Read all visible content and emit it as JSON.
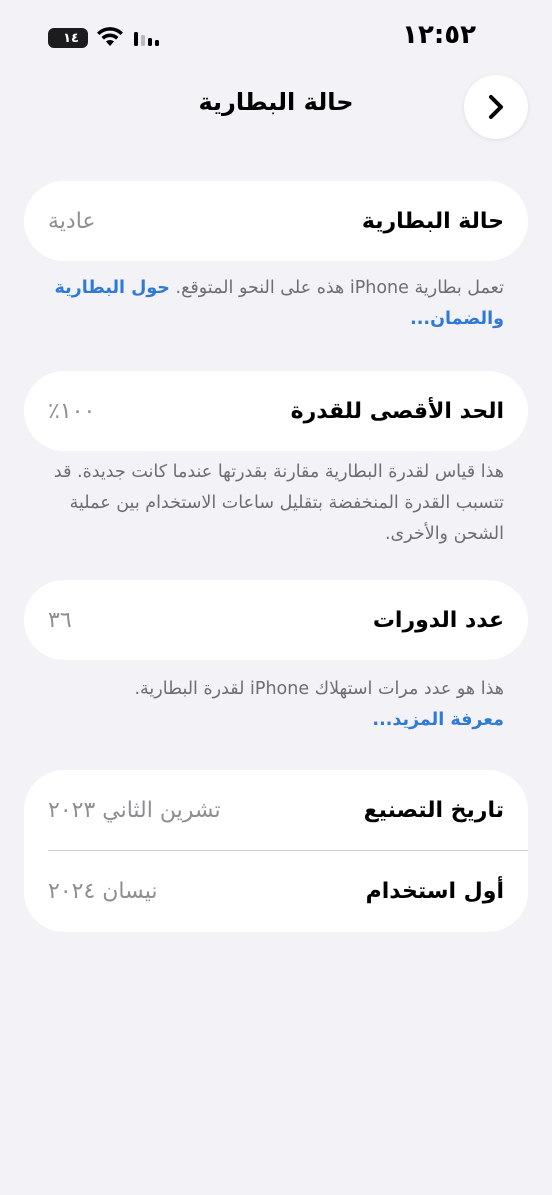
{
  "status_bar": {
    "time": "١٢:٥٢",
    "battery_level": "١٤",
    "icons": [
      "battery-icon",
      "wifi-icon",
      "cellular-signal-icon"
    ]
  },
  "nav": {
    "title": "حالة البطارية",
    "back_icon": "chevron-right-icon"
  },
  "battery_health": {
    "label": "حالة البطارية",
    "value": "عادية",
    "footnote_text": "تعمل بطارية iPhone هذه على النحو المتوقع.",
    "footnote_link": "حول البطارية والضمان..."
  },
  "max_capacity": {
    "label": "الحد الأقصى للقدرة",
    "value": "١٠٠٪",
    "footnote_text": "هذا قياس لقدرة البطارية مقارنة بقدرتها عندما كانت جديدة. قد تتسبب القدرة المنخفضة بتقليل ساعات الاستخدام بين عملية الشحن والأخرى."
  },
  "cycle_count": {
    "label": "عدد الدورات",
    "value": "٣٦",
    "footnote_text": "هذا هو عدد مرات استهلاك iPhone لقدرة البطارية.",
    "footnote_link": "معرفة المزيد..."
  },
  "dates": {
    "manufacture_label": "تاريخ التصنيع",
    "manufacture_value": "تشرين الثاني ٢٠٢٣",
    "first_use_label": "أول استخدام",
    "first_use_value": "نيسان ٢٠٢٤"
  },
  "colors": {
    "background": "#f2f2f7",
    "card": "#ffffff",
    "link": "#2f7ad6",
    "secondary_text": "#8e8e93"
  }
}
